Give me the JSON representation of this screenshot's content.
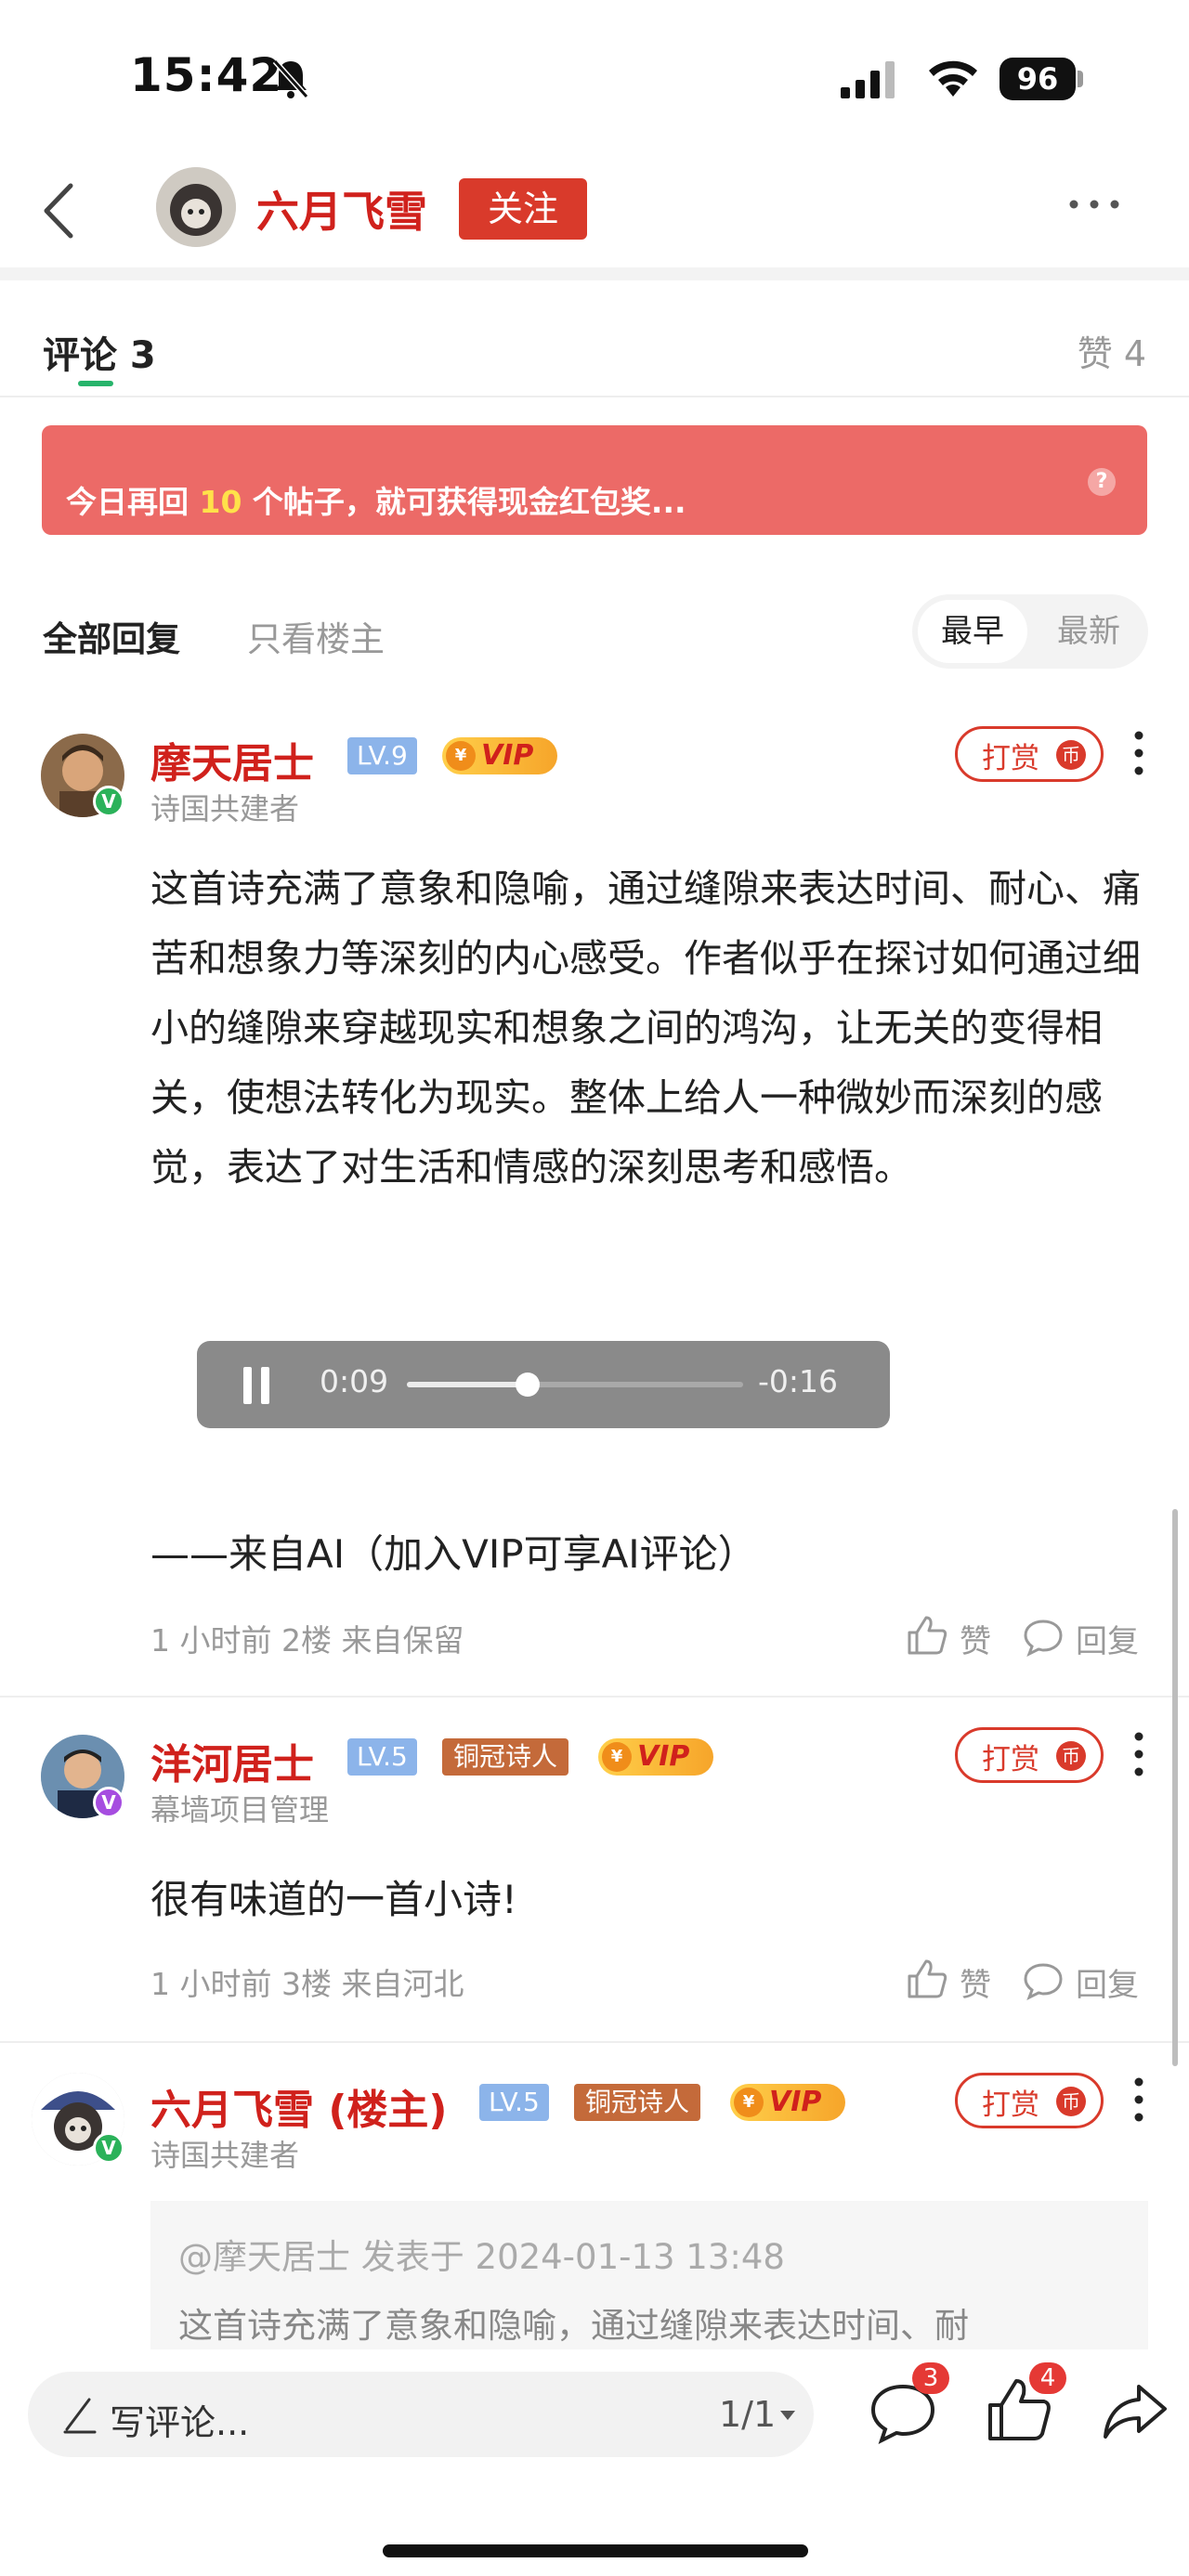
{
  "status_bar": {
    "time": "15:42",
    "battery": "96"
  },
  "header": {
    "author": "六月飞雪",
    "follow_label": "关注"
  },
  "tabs": {
    "comments_label": "评论 3",
    "likes_label": "赞 4"
  },
  "banner": {
    "text_before": "今日再回 ",
    "highlight": "10",
    "text_after": " 个帖子，就可获得现金红包奖...",
    "help_symbol": "?"
  },
  "filters": {
    "all_label": "全部回复",
    "owner_only_label": "只看楼主",
    "sort_early": "最早",
    "sort_new": "最新"
  },
  "common": {
    "tip_label": "打赏",
    "tip_symbol": "币",
    "vip_label": "VIP",
    "like_label": "赞",
    "reply_label": "回复",
    "verify_mark": "V"
  },
  "comments": [
    {
      "name": "摩天居士",
      "level": "LV.9",
      "subtitle": "诗国共建者",
      "body": "这首诗充满了意象和隐喻，通过缝隙来表达时间、耐心、痛苦和想象力等深刻的内心感受。作者似乎在探讨如何通过细小的缝隙来穿越现实和想象之间的鸿沟，让无关的变得相关，使想法转化为现实。整体上给人一种微妙而深刻的感觉，表达了对生活和情感的深刻思考和感悟。",
      "audio": {
        "current": "0:09",
        "remaining": "-0:16",
        "progress": 0.36
      },
      "ai_note": "——来自AI（加入VIP可享AI评论）",
      "meta": "1 小时前  2楼  来自保留"
    },
    {
      "name": "洋河居士",
      "level": "LV.5",
      "title_badge": "铜冠诗人",
      "subtitle": "幕墙项目管理",
      "body": "很有味道的一首小诗!",
      "meta": "1 小时前  3楼  来自河北"
    },
    {
      "name": "六月飞雪 (楼主)",
      "level": "LV.5",
      "title_badge": "铜冠诗人",
      "subtitle": "诗国共建者",
      "quote_head": "@摩天居士 发表于 2024-01-13 13:48",
      "quote_text": "这首诗充满了意象和隐喻，通过缝隙来表达时间、耐"
    }
  ],
  "bottom_bar": {
    "write_placeholder": "写评论...",
    "page_indicator": "1/1",
    "comment_count": "3",
    "like_count": "4"
  }
}
